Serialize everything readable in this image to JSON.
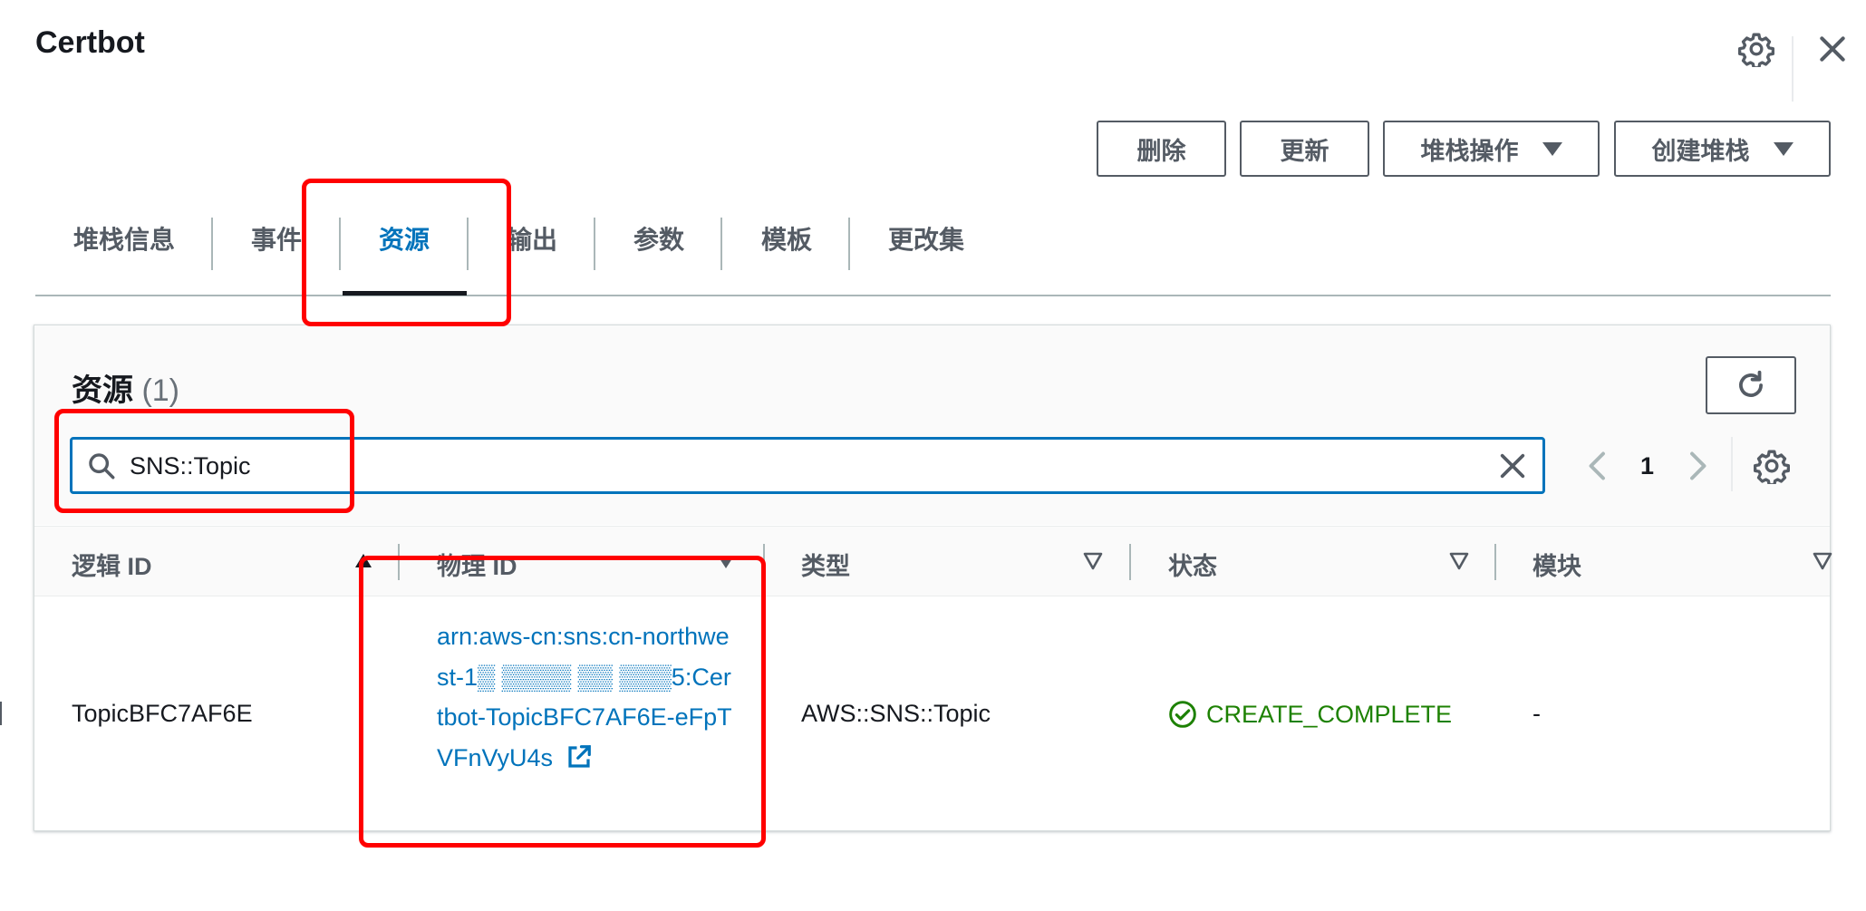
{
  "header": {
    "title": "Certbot",
    "icons": [
      "gear-icon",
      "close-icon"
    ]
  },
  "actions": {
    "delete_label": "删除",
    "update_label": "更新",
    "stack_actions_label": "堆栈操作",
    "create_stack_label": "创建堆栈"
  },
  "tabs": [
    {
      "label": "堆栈信息",
      "active": false
    },
    {
      "label": "事件",
      "active": false
    },
    {
      "label": "资源",
      "active": true
    },
    {
      "label": "输出",
      "active": false
    },
    {
      "label": "参数",
      "active": false
    },
    {
      "label": "模板",
      "active": false
    },
    {
      "label": "更改集",
      "active": false
    }
  ],
  "resources": {
    "title": "资源",
    "count": "(1)",
    "search_value": "SNS::Topic",
    "page": "1",
    "columns": [
      "逻辑 ID",
      "物理 ID",
      "类型",
      "状态",
      "模块"
    ],
    "rows": [
      {
        "logical_id": "TopicBFC7AF6E",
        "physical_id": "arn:aws-cn:sns:cn-northwest-1▒ ▒▒▒▒ ▒▒ ▒▒▒5:Certbot-TopicBFC7AF6E-eFpTVFnVyU4s",
        "type": "AWS::SNS::Topic",
        "status": "CREATE_COMPLETE",
        "module": "-"
      }
    ]
  },
  "colors": {
    "link": "#0073bb",
    "success": "#1d8102",
    "highlight": "#ff0000",
    "text": "#16191f",
    "muted": "#545b64"
  }
}
